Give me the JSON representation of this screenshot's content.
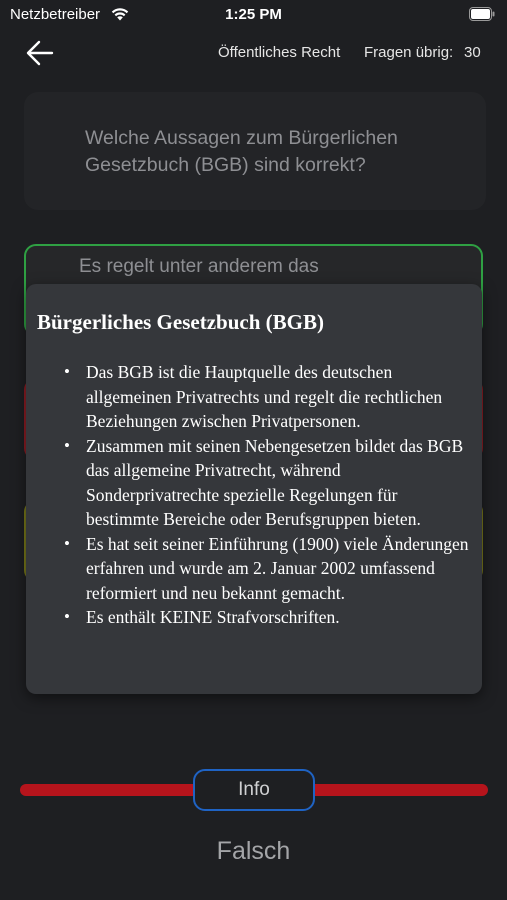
{
  "status_bar": {
    "carrier": "Netzbetreiber",
    "time": "1:25 PM"
  },
  "nav": {
    "category": "Öffentliches Recht",
    "remaining_label": "Fragen übrig:",
    "remaining_count": "30"
  },
  "question": {
    "text": "Welche Aussagen zum Bürgerlichen Gesetzbuch (BGB) sind korrekt?"
  },
  "answers": [
    {
      "text": "Es regelt unter anderem das",
      "border_color": "#2fa043"
    },
    {
      "text": "",
      "border_color": "#8c1d24"
    },
    {
      "text": "",
      "border_color": "#7a7a1a"
    }
  ],
  "info_popover": {
    "title": "Bürgerliches Gesetzbuch (BGB)",
    "bullet": "•",
    "items": [
      "Das BGB ist die Hauptquelle des deutschen allgemeinen Privatrechts und regelt die rechtlichen Beziehungen zwischen Privatpersonen.",
      "Zusammen mit seinen Nebengesetzen bildet das BGB das allgemeine Privatrecht, während Sonderprivatrechte spezielle Regelungen für bestimmte Bereiche oder Berufsgruppen bieten.",
      "Es hat seit seiner Einführung (1900) viele Änderungen erfahren und wurde am 2. Januar 2002 umfassend reformiert und neu bekannt gemacht.",
      "Es enthält KEINE Strafvorschriften."
    ]
  },
  "bottom": {
    "info_button_label": "Info",
    "result_label": "Falsch",
    "progress_color": "#b6141c",
    "info_button_border": "#1f63c4"
  }
}
